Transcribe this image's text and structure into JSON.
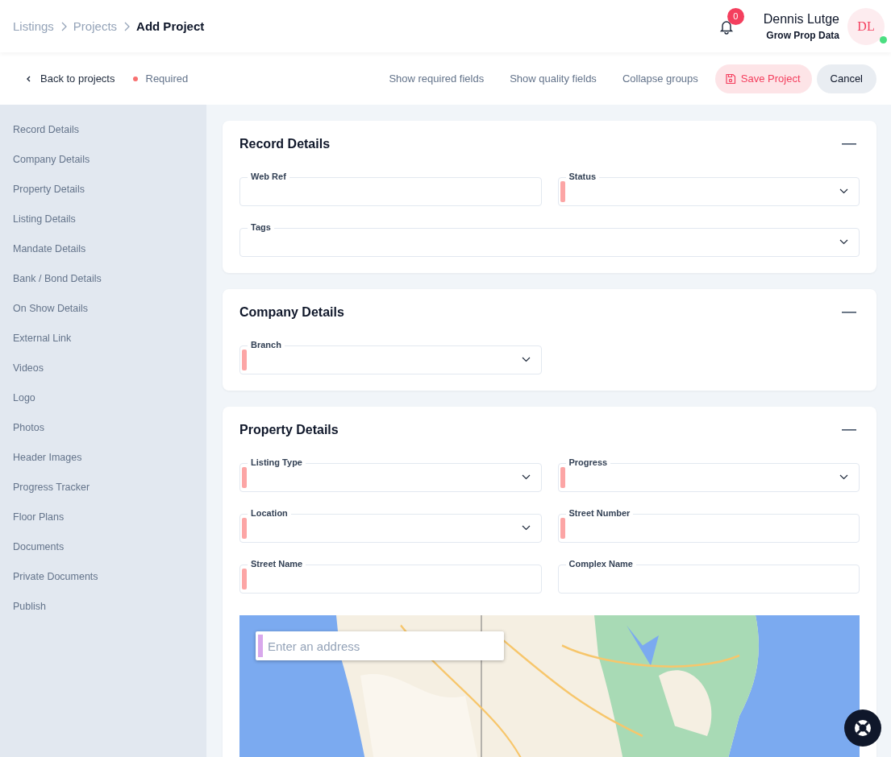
{
  "breadcrumb": [
    {
      "label": "Listings",
      "current": false
    },
    {
      "label": "Projects",
      "current": false
    },
    {
      "label": "Add Project",
      "current": true
    }
  ],
  "notifications": {
    "count": "0"
  },
  "user": {
    "name": "Dennis Lutge",
    "company": "Grow Prop Data",
    "initials": "DL",
    "online": true
  },
  "toolbar": {
    "back": "Back to projects",
    "legend": "Required",
    "actions": [
      "Show required fields",
      "Show quality fields",
      "Collapse groups"
    ],
    "save": "Save Project",
    "cancel": "Cancel"
  },
  "sidebar": {
    "items": [
      "Record Details",
      "Company Details",
      "Property Details",
      "Listing Details",
      "Mandate Details",
      "Bank / Bond Details",
      "On Show Details",
      "External Link",
      "Videos",
      "Logo",
      "Photos",
      "Header Images",
      "Progress Tracker",
      "Floor Plans",
      "Documents",
      "Private Documents",
      "Publish"
    ]
  },
  "sections": [
    {
      "title": "Record Details",
      "fields": [
        {
          "label": "Web Ref",
          "kind": "text",
          "required": false,
          "wide": false
        },
        {
          "label": "Status",
          "kind": "select",
          "required": true,
          "wide": false
        },
        {
          "label": "Tags",
          "kind": "select",
          "required": false,
          "wide": true
        }
      ]
    },
    {
      "title": "Company Details",
      "fields": [
        {
          "label": "Branch",
          "kind": "select",
          "required": true,
          "wide": false
        }
      ]
    },
    {
      "title": "Property Details",
      "fields": [
        {
          "label": "Listing Type",
          "kind": "select",
          "required": true,
          "wide": false
        },
        {
          "label": "Progress",
          "kind": "select",
          "required": true,
          "wide": false
        },
        {
          "label": "Location",
          "kind": "select",
          "required": true,
          "wide": false
        },
        {
          "label": "Street Number",
          "kind": "text",
          "required": true,
          "wide": false
        },
        {
          "label": "Street Name",
          "kind": "text",
          "required": true,
          "wide": false
        },
        {
          "label": "Complex Name",
          "kind": "text",
          "required": false,
          "wide": false
        }
      ],
      "map": {
        "kind": "picture",
        "search": {
          "placeholder": "Enter an address"
        }
      }
    }
  ]
}
